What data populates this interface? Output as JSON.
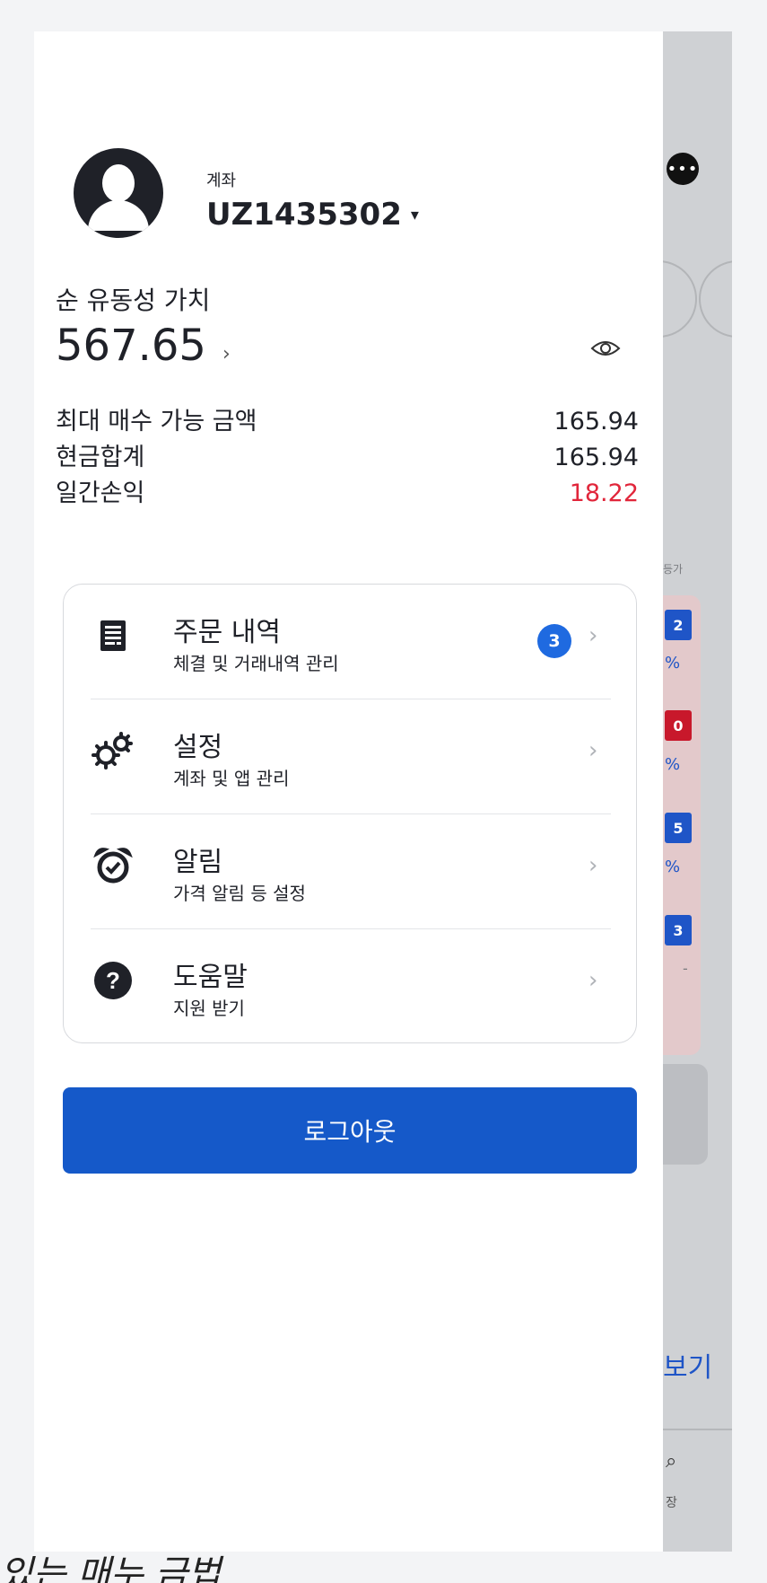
{
  "account": {
    "label": "계좌",
    "number": "UZ1435302",
    "caret": "▾"
  },
  "net_liquidation": {
    "label": "순 유동성 가치",
    "value": "567.65",
    "chevron": "›",
    "visibility_icon": "eye-icon"
  },
  "stats": [
    {
      "label": "최대 매수 가능 금액",
      "value": "165.94"
    },
    {
      "label": "현금합계",
      "value": "165.94"
    },
    {
      "label": "일간손익",
      "value": "18.22"
    }
  ],
  "menu": [
    {
      "icon": "receipt-icon",
      "title": "주문 내역",
      "subtitle": "체결 및 거래내역 관리",
      "badge": "3",
      "chevron": "›"
    },
    {
      "icon": "gears-icon",
      "title": "설정",
      "subtitle": "계좌 및 앱 관리",
      "chevron": "›"
    },
    {
      "icon": "alarm-clock-icon",
      "title": "알림",
      "subtitle": "가격 알림 등 설정",
      "chevron": "›"
    },
    {
      "icon": "help-icon",
      "title": "도움말",
      "subtitle": "지원 받기",
      "chevron": "›"
    }
  ],
  "logout_label": "로그아웃",
  "colors": {
    "primary": "#1559c9",
    "badge": "#1f6ae0",
    "loss": "#e1263b"
  },
  "background_app": {
    "small_label": "등가",
    "tags": [
      "2",
      "0",
      "5",
      "3"
    ],
    "pcts": [
      "%",
      "%",
      "%",
      "-"
    ],
    "link_text": "보기",
    "nav_label": "장"
  },
  "bottom_overflow_text": "있는 매누 금법"
}
